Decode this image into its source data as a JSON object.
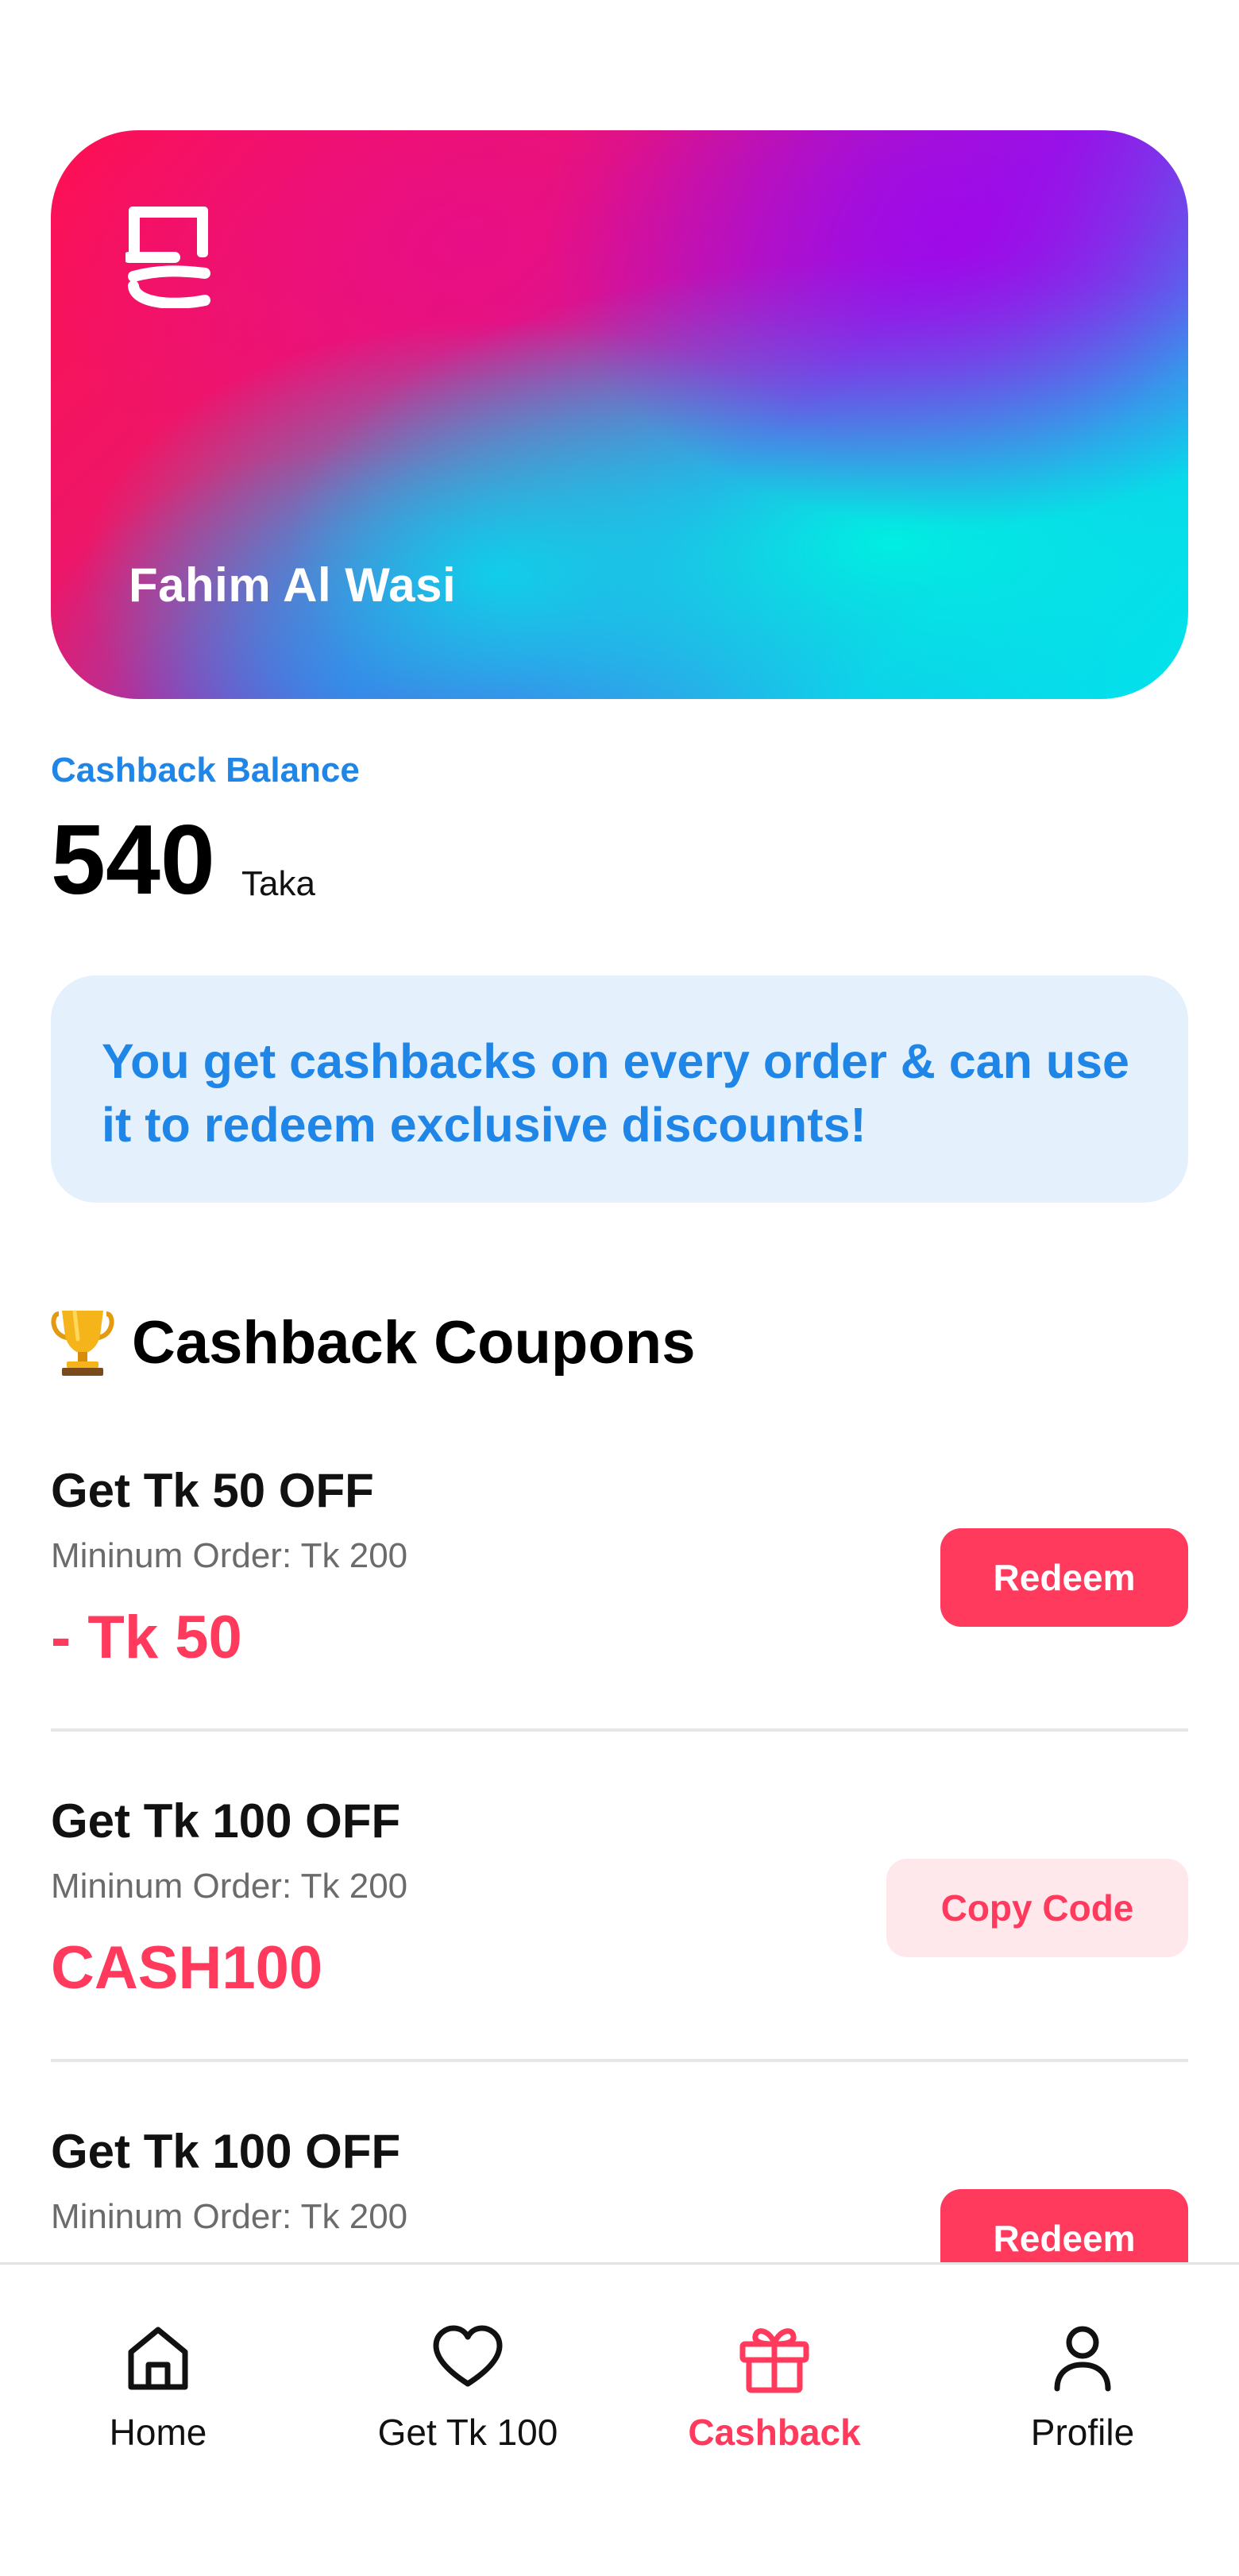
{
  "card": {
    "name": "Fahim Al Wasi",
    "logo_icon": "brand-logo-icon"
  },
  "balance": {
    "label": "Cashback Balance",
    "amount": "540",
    "unit": "Taka"
  },
  "info": {
    "text": "You get cashbacks on every order & can use it to redeem exclusive discounts!"
  },
  "section": {
    "emoji_icon": "trophy-icon",
    "title": "Cashback Coupons"
  },
  "coupons": [
    {
      "title": "Get Tk 50 OFF",
      "min_order": "Mininum Order: Tk 200",
      "value": "- Tk 50",
      "action": "Redeem",
      "action_type": "redeem"
    },
    {
      "title": "Get Tk 100 OFF",
      "min_order": "Mininum Order: Tk 200",
      "value": "CASH100",
      "action": "Copy Code",
      "action_type": "copy"
    },
    {
      "title": "Get Tk 100 OFF",
      "min_order": "Mininum Order: Tk 200",
      "action": "Redeem",
      "action_type": "redeem"
    }
  ],
  "nav": {
    "items": [
      {
        "label": "Home",
        "icon": "home-icon",
        "active": false
      },
      {
        "label": "Get Tk 100",
        "icon": "heart-icon",
        "active": false
      },
      {
        "label": "Cashback",
        "icon": "gift-icon",
        "active": true
      },
      {
        "label": "Profile",
        "icon": "user-icon",
        "active": false
      }
    ]
  },
  "colors": {
    "accent": "#ff3a5c",
    "accent_light": "#ffe8ec",
    "link_blue": "#1f86e8",
    "info_bg": "#e4f1fc",
    "text": "#111111",
    "muted": "#6b6b6b"
  }
}
